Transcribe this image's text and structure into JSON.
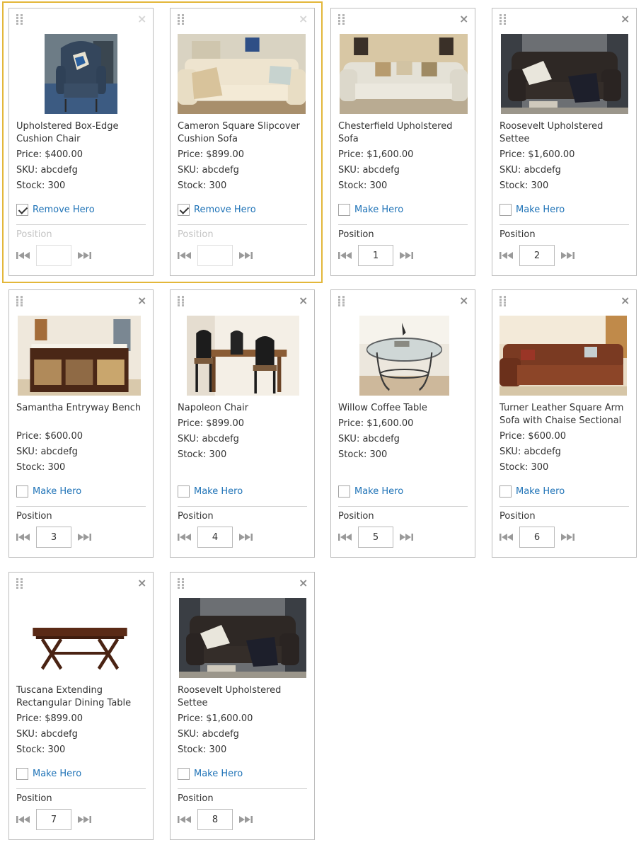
{
  "labels": {
    "price_prefix": "Price: ",
    "sku_prefix": "SKU: ",
    "stock_prefix": "Stock: ",
    "position": "Position",
    "make_hero": "Make Hero",
    "remove_hero": "Remove Hero"
  },
  "colors": {
    "hero_outline": "#e3b73a",
    "link": "#1f73b7",
    "card_border": "#bdbdbd"
  },
  "icons": {
    "drag": "drag-handle-icon",
    "close": "close-icon",
    "prev": "first-icon",
    "next": "last-icon",
    "check": "checkmark-icon"
  },
  "products": [
    {
      "name": "Upholstered Box-Edge Cushion Chair",
      "price": "Price: $400.00",
      "sku": "SKU: abcdefg",
      "stock": "Stock: 300",
      "hero": true,
      "hero_label": "Remove Hero",
      "position": ""
    },
    {
      "name": "Cameron Square Slipcover Cushion Sofa",
      "price": "Price: $899.00",
      "sku": "SKU: abcdefg",
      "stock": "Stock: 300",
      "hero": true,
      "hero_label": "Remove Hero",
      "position": ""
    },
    {
      "name": "Chesterfield Upholstered Sofa",
      "price": "Price: $1,600.00",
      "sku": "SKU: abcdefg",
      "stock": "Stock: 300",
      "hero": false,
      "hero_label": "Make Hero",
      "position": "1"
    },
    {
      "name": "Roosevelt Upholstered Settee",
      "price": "Price: $1,600.00",
      "sku": "SKU: abcdefg",
      "stock": "Stock: 300",
      "hero": false,
      "hero_label": "Make Hero",
      "position": "2"
    },
    {
      "name": "Samantha Entryway Bench",
      "price": "Price: $600.00",
      "sku": "SKU: abcdefg",
      "stock": "Stock: 300",
      "hero": false,
      "hero_label": "Make Hero",
      "position": "3"
    },
    {
      "name": "Napoleon Chair",
      "price": "Price: $899.00",
      "sku": "SKU: abcdefg",
      "stock": "Stock: 300",
      "hero": false,
      "hero_label": "Make Hero",
      "position": "4"
    },
    {
      "name": "Willow Coffee Table",
      "price": "Price: $1,600.00",
      "sku": "SKU: abcdefg",
      "stock": "Stock: 300",
      "hero": false,
      "hero_label": "Make Hero",
      "position": "5"
    },
    {
      "name": "Turner Leather Square Arm Sofa with Chaise Sectional",
      "price": "Price: $600.00",
      "sku": "SKU: abcdefg",
      "stock": "Stock: 300",
      "hero": false,
      "hero_label": "Make Hero",
      "position": "6"
    },
    {
      "name": "Tuscana Extending Rectangular Dining Table",
      "price": "Price: $899.00",
      "sku": "SKU: abcdefg",
      "stock": "Stock: 300",
      "hero": false,
      "hero_label": "Make Hero",
      "position": "7"
    },
    {
      "name": "Roosevelt Upholstered Settee",
      "price": "Price: $1,600.00",
      "sku": "SKU: abcdefg",
      "stock": "Stock: 300",
      "hero": false,
      "hero_label": "Make Hero",
      "position": "8"
    }
  ]
}
